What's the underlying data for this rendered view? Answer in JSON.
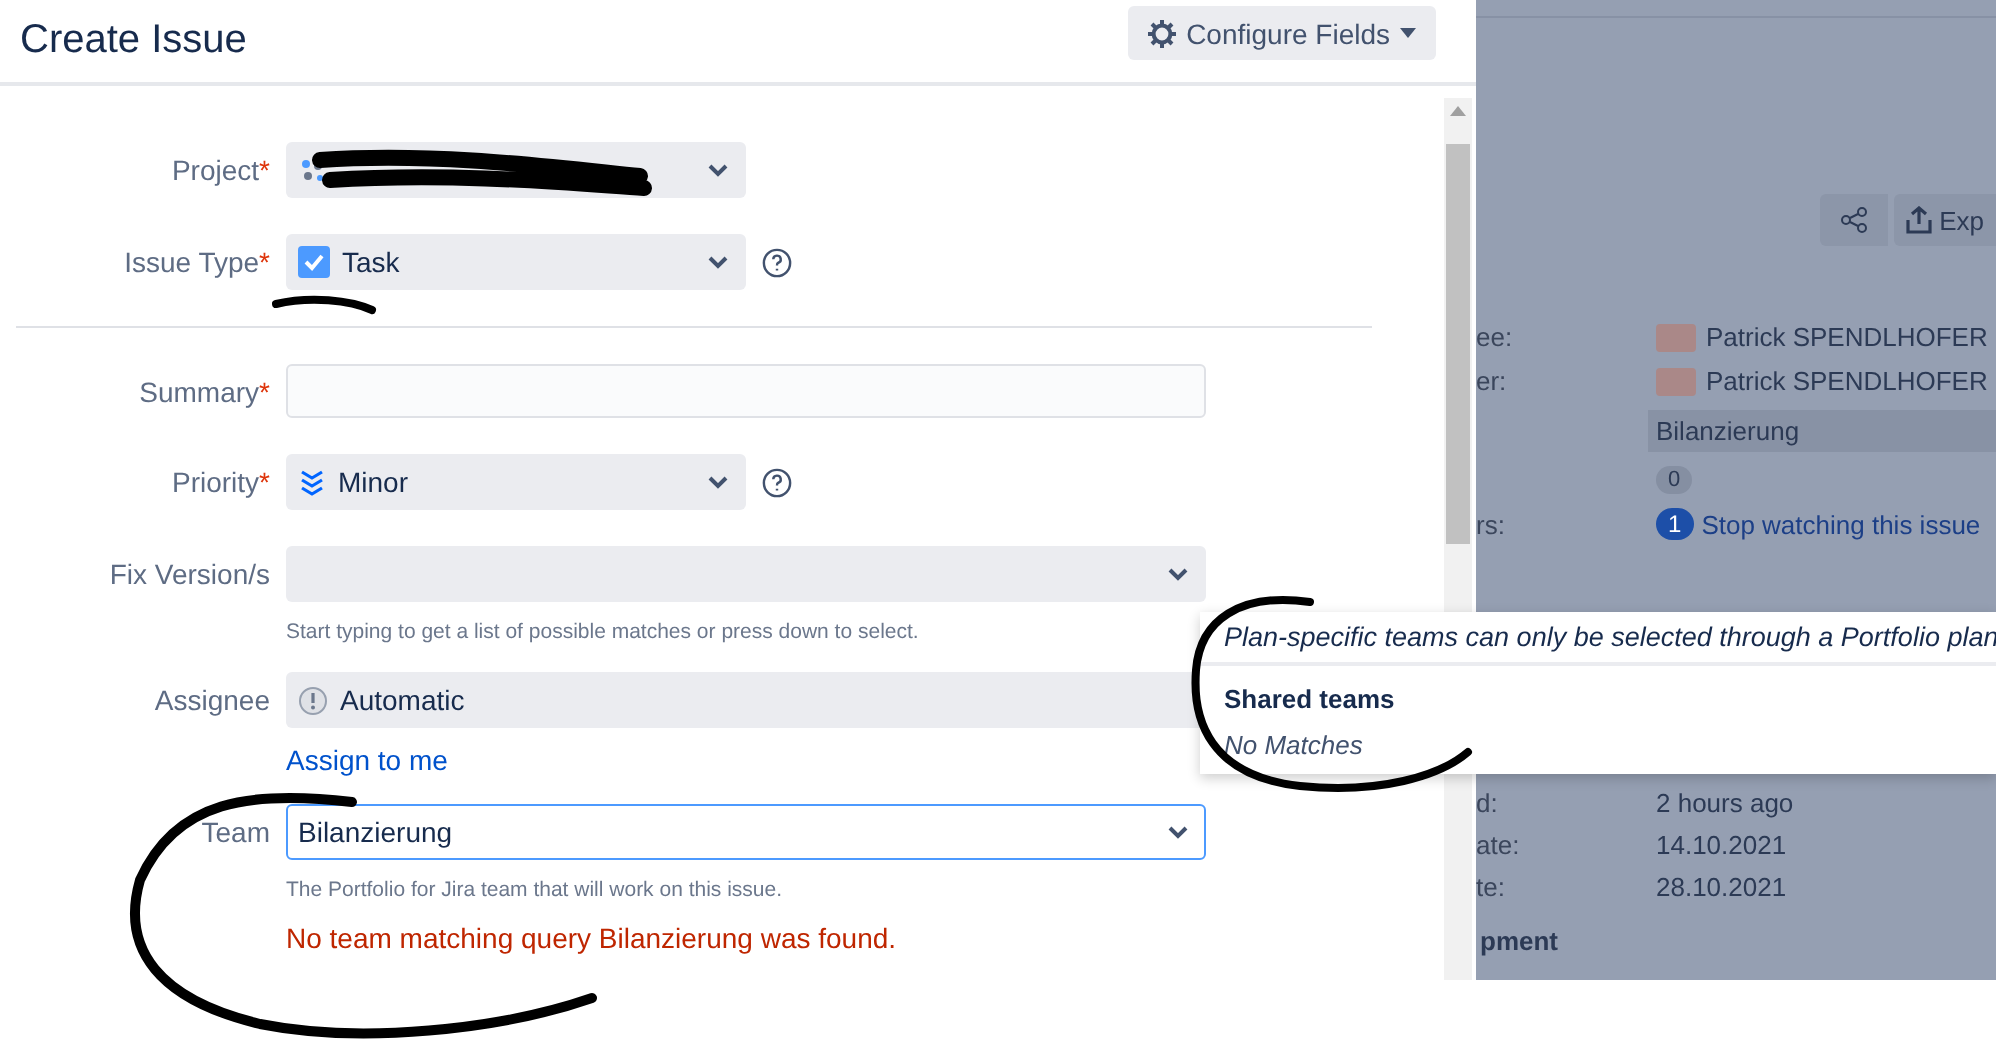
{
  "dialog": {
    "title": "Create Issue",
    "configure_button": "Configure Fields",
    "fields": [
      {
        "kind": "project",
        "label": "Project",
        "required_mark": "*",
        "redacted": true,
        "help": false
      },
      {
        "kind": "issuetype",
        "label": "Issue Type",
        "required_mark": "*",
        "value": "Task",
        "help": true,
        "divider_after": true
      },
      {
        "kind": "summary",
        "label": "Summary",
        "required_mark": "*",
        "help": false
      },
      {
        "kind": "priority",
        "label": "Priority",
        "required_mark": "*",
        "value": "Minor",
        "help": true
      },
      {
        "kind": "version",
        "label": "Fix Version/s",
        "help": false,
        "hint": "Start typing to get a list of possible matches or press down to select."
      },
      {
        "kind": "assignee",
        "label": "Assignee",
        "value": "Automatic",
        "help": false,
        "link": "Assign to me"
      },
      {
        "kind": "team",
        "label": "Team",
        "value": "Bilanzierung",
        "help": false,
        "focused": true,
        "hint": "The Portfolio for Jira team that will work on this issue.",
        "error": "No team matching query Bilanzierung was found."
      }
    ]
  },
  "dropdown": {
    "note": "Plan-specific teams can only be selected through a Portfolio plan",
    "group_heading": "Shared teams",
    "empty_text": "No Matches"
  },
  "background": {
    "toolbar": [
      {
        "kind": "share"
      },
      {
        "kind": "export",
        "label": "Exp"
      }
    ],
    "details": [
      {
        "kind": "user",
        "label": "ee:",
        "value": "Patrick SPENDLHOFER"
      },
      {
        "kind": "user",
        "label": "er:",
        "value": "Patrick SPENDLHOFER"
      },
      {
        "kind": "tag",
        "value": "Bilanzierung"
      },
      {
        "kind": "count",
        "value": "0"
      },
      {
        "kind": "watchers",
        "label": "rs:",
        "count": "1",
        "value": "Stop watching this issue"
      }
    ],
    "dates": [
      {
        "label": "d:",
        "value": "2 hours ago"
      },
      {
        "label": "ate:",
        "value": "14.10.2021"
      },
      {
        "label": "te:",
        "value": "28.10.2021"
      }
    ],
    "section": "pment"
  }
}
